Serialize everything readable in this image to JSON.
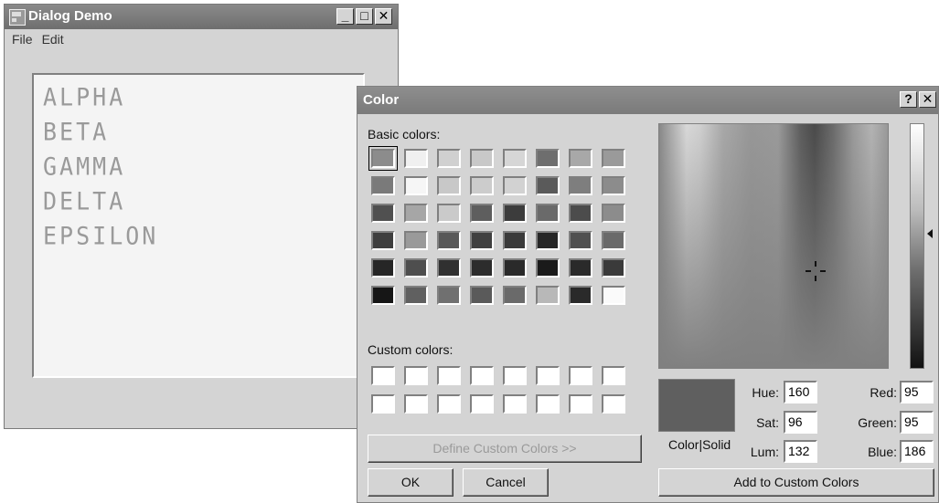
{
  "back_window": {
    "title": "Dialog Demo",
    "menu": [
      "File",
      "Edit"
    ],
    "list_items": [
      "ALPHA",
      "BETA",
      "GAMMA",
      "DELTA",
      "EPSILON"
    ],
    "controls": {
      "minimize": "_",
      "maximize": "□",
      "close": "✕"
    }
  },
  "color_dialog": {
    "title": "Color",
    "controls": {
      "help": "?",
      "close": "✕"
    },
    "basic_colors_label": "Basic colors:",
    "custom_colors_label": "Custom colors:",
    "basic_colors": [
      "#8c8c8c",
      "#f0f0f0",
      "#d0d0d0",
      "#c8c8c8",
      "#d6d6d6",
      "#6e6e6e",
      "#a8a8a8",
      "#9a9a9a",
      "#7a7a7a",
      "#f6f6f6",
      "#c8c8c8",
      "#cccccc",
      "#d2d2d2",
      "#5a5a5a",
      "#7e7e7e",
      "#8c8c8c",
      "#505050",
      "#a6a6a6",
      "#cacaca",
      "#5e5e5e",
      "#3c3c3c",
      "#6a6a6a",
      "#4c4c4c",
      "#8c8c8c",
      "#3e3e3e",
      "#9a9a9a",
      "#585858",
      "#404040",
      "#3a3a3a",
      "#262626",
      "#505050",
      "#6a6a6a",
      "#262626",
      "#4e4e4e",
      "#303030",
      "#2c2c2c",
      "#2a2a2a",
      "#1a1a1a",
      "#2a2a2a",
      "#3a3a3a",
      "#161616",
      "#606060",
      "#707070",
      "#5a5a5a",
      "#6a6a6a",
      "#b8b8b8",
      "#2a2a2a",
      "#fafafa"
    ],
    "selected_basic_index": 0,
    "custom_colors": [
      "#ffffff",
      "#ffffff",
      "#ffffff",
      "#ffffff",
      "#ffffff",
      "#ffffff",
      "#ffffff",
      "#ffffff",
      "#ffffff",
      "#ffffff",
      "#ffffff",
      "#ffffff",
      "#ffffff",
      "#ffffff",
      "#ffffff",
      "#ffffff"
    ],
    "define_custom_label": "Define Custom Colors >>",
    "ok_label": "OK",
    "cancel_label": "Cancel",
    "color_solid_label": "Color|Solid",
    "current_color": "#5f5f5f",
    "fields": {
      "hue": {
        "label": "Hue:",
        "value": "160"
      },
      "sat": {
        "label": "Sat:",
        "value": "96"
      },
      "lum": {
        "label": "Lum:",
        "value": "132"
      },
      "red": {
        "label": "Red:",
        "value": "95"
      },
      "green": {
        "label": "Green:",
        "value": "95"
      },
      "blue": {
        "label": "Blue:",
        "value": "186"
      }
    },
    "add_custom_label": "Add to Custom Colors"
  }
}
